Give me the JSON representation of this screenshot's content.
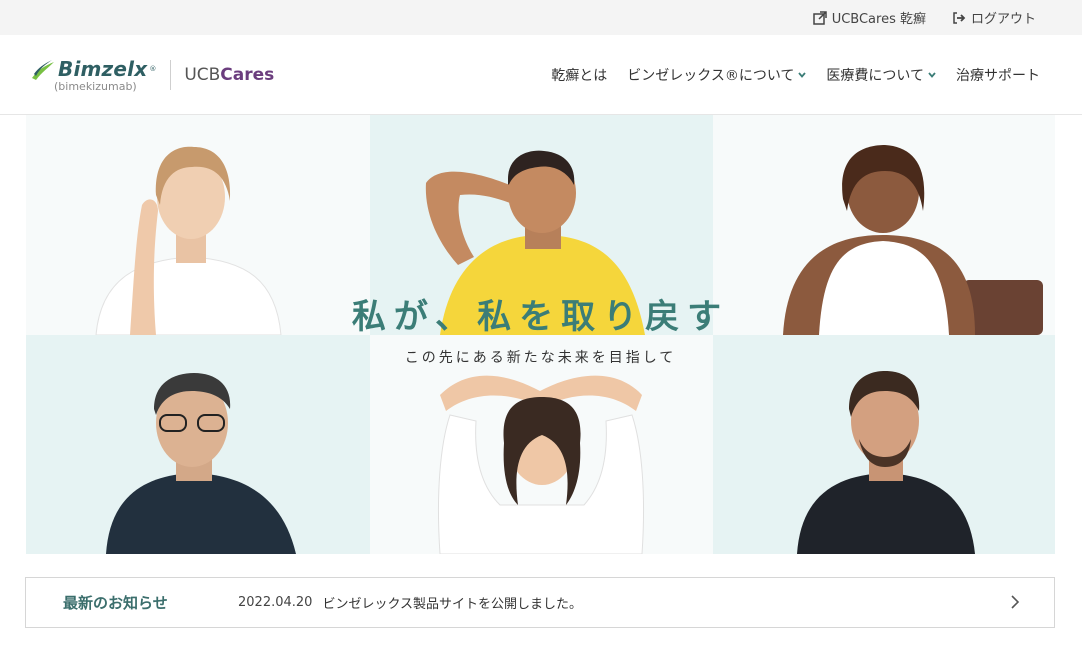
{
  "utility": {
    "ucbcares_link": "UCBCares 乾癬",
    "logout": "ログアウト"
  },
  "logo": {
    "brand": "Bimzelx",
    "brand_mark": "®",
    "generic": "(bimekizumab)",
    "partner_prefix": "UCB",
    "partner_suffix": "Cares"
  },
  "nav": {
    "items": [
      {
        "label": "乾癬とは",
        "dropdown": false
      },
      {
        "label": "ビンゼレックス®について",
        "dropdown": true
      },
      {
        "label": "医療費について",
        "dropdown": true
      },
      {
        "label": "治療サポート",
        "dropdown": false
      }
    ]
  },
  "hero": {
    "title": "私が、私を取り戻す",
    "subtitle": "この先にある新たな未来を目指して"
  },
  "news": {
    "label": "最新のお知らせ",
    "date": "2022.04.20",
    "text": "ビンゼレックス製品サイトを公開しました。"
  },
  "colors": {
    "accent_teal": "#3b7d77",
    "tile_light": "#e6f3f3",
    "tile_white": "#f7fafa",
    "brand_purple": "#6b3d7e",
    "logo_green": "#78c043"
  }
}
